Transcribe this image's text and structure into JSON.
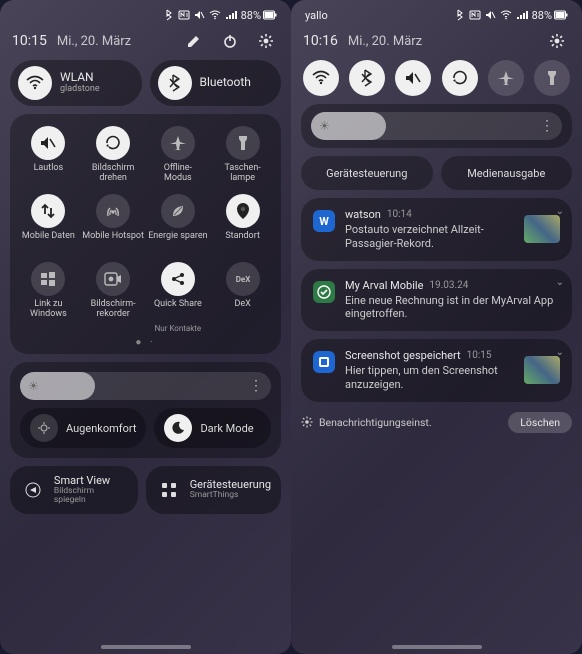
{
  "left": {
    "status": {
      "battery": "88%"
    },
    "header": {
      "time": "10:15",
      "date": "Mi., 20. März"
    },
    "toggles": {
      "wifi": {
        "title": "WLAN",
        "sub": "gladstone"
      },
      "bt": {
        "title": "Bluetooth"
      }
    },
    "qsItems": [
      {
        "label": "Lautlos",
        "icon": "mute"
      },
      {
        "label": "Bildschirm drehen",
        "icon": "rotate"
      },
      {
        "label": "Offline-Modus",
        "icon": "airplane"
      },
      {
        "label": "Taschen-lampe",
        "icon": "flash"
      },
      {
        "label": "Mobile Daten",
        "icon": "data"
      },
      {
        "label": "Mobile Hotspot",
        "icon": "hotspot"
      },
      {
        "label": "Energie sparen",
        "icon": "leaf"
      },
      {
        "label": "Standort",
        "icon": "location"
      },
      {
        "label": "Link zu Windows",
        "icon": "windows"
      },
      {
        "label": "Bildschirm-rekorder",
        "icon": "record"
      },
      {
        "label": "Quick Share",
        "sub": "Nur Kontakte",
        "icon": "share"
      },
      {
        "label": "DeX",
        "icon": "dex"
      }
    ],
    "brightness": {
      "percent": 30
    },
    "brightButtons": {
      "eye": {
        "label": "Augenkomfort"
      },
      "dark": {
        "label": "Dark Mode"
      }
    },
    "bottom": {
      "smartview": {
        "title": "Smart View",
        "sub": "Bildschirm spiegeln"
      },
      "devices": {
        "title": "Gerätesteuerung",
        "sub": "SmartThings"
      }
    }
  },
  "right": {
    "status": {
      "carrier": "yallo",
      "battery": "88%"
    },
    "header": {
      "time": "10:16",
      "date": "Mi., 20. März"
    },
    "brightness": {
      "percent": 30
    },
    "pills": {
      "devices": "Gerätesteuerung",
      "media": "Medienausgabe"
    },
    "notifs": [
      {
        "app": "watson",
        "ts": "10:14",
        "msg": "Postauto verzeichnet Allzeit-Passagier-Rekord.",
        "color": "#1e66d0",
        "letter": "W",
        "thumb": true
      },
      {
        "app": "My Arval Mobile",
        "ts": "19.03.24",
        "msg": "Eine neue Rechnung ist in der MyArval App eingetroffen.",
        "color": "#2e7a46",
        "letter": ""
      },
      {
        "app": "Screenshot gespeichert",
        "ts": "10:15",
        "msg": "Hier tippen, um den Screenshot anzuzeigen.",
        "color": "#1e66d0",
        "letter": "",
        "thumb": true
      }
    ],
    "footer": {
      "settings": "Benachrichtigungseinst.",
      "clear": "Löschen"
    }
  }
}
